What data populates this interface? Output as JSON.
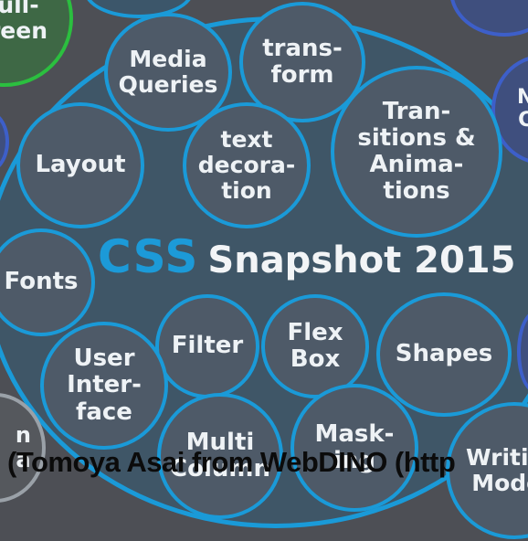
{
  "colors": {
    "background": "#4d4f55",
    "bubble_border": "#1a9ad8",
    "bubble_fill": "#4e5a68",
    "css_word": "#1c9ad8",
    "caption": "#0b0b0b"
  },
  "title": {
    "css": "CSS",
    "rest": "Snapshot 2015"
  },
  "bubbles": {
    "media_queries": "Media\nQueries",
    "transform": "trans-\nform",
    "transitions": "Tran-\nsitions &\nAnima-\ntions",
    "layout": "Layout",
    "text_decoration": "text\ndecora-\ntion",
    "fonts": "Fonts",
    "filter": "Filter",
    "flexbox": "Flex\nBox",
    "shapes": "Shapes",
    "user_interface": "User\nInter-\nface",
    "multi_column": "Multi\nColumn",
    "masking": "Mask-\ning",
    "writing_modes": "Writing\nModes",
    "fullscreen": "ull-\nreen",
    "partial_left": "n\na",
    "partial_right": "N\nC"
  },
  "caption": "(Tomoya Asai from WebDINO  (http"
}
